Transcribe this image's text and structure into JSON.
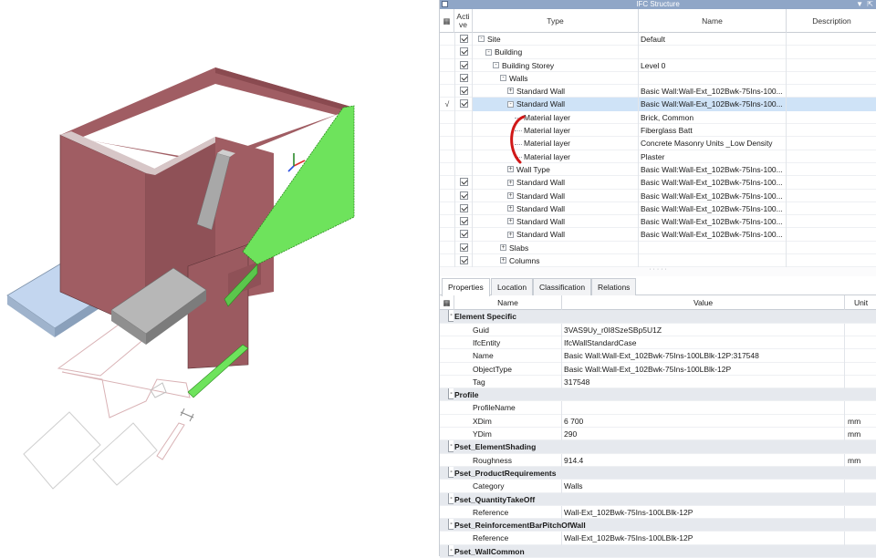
{
  "viewport": {
    "model_colors": {
      "wall": "#a05d63",
      "wall_top": "#d7d7d7",
      "selected": "#6ee35c",
      "slab": "#c3d6ef",
      "column": "#a8a8a8"
    }
  },
  "structure_panel": {
    "title": "IFC Structure",
    "columns": {
      "active": "Acti ve",
      "type": "Type",
      "name": "Name",
      "description": "Description"
    },
    "rows": [
      {
        "type": "Site",
        "name": "Default",
        "active": true,
        "marked": false
      },
      {
        "type": "Building",
        "name": "",
        "active": true,
        "marked": false
      },
      {
        "type": "Building Storey",
        "name": "Level 0",
        "active": true,
        "marked": false
      },
      {
        "type": "Walls",
        "name": "",
        "active": true,
        "marked": false
      },
      {
        "type": "Standard Wall",
        "name": "Basic Wall:Wall-Ext_102Bwk-75Ins-100...",
        "active": true,
        "marked": false
      },
      {
        "type": "Standard Wall",
        "name": "Basic Wall:Wall-Ext_102Bwk-75Ins-100...",
        "active": true,
        "marked": true
      },
      {
        "type": "Material layer",
        "name": "Brick, Common",
        "active": false,
        "marked": false
      },
      {
        "type": "Material layer",
        "name": "Fiberglass Batt",
        "active": false,
        "marked": false
      },
      {
        "type": "Material layer",
        "name": "Concrete Masonry Units _Low Density",
        "active": false,
        "marked": false
      },
      {
        "type": "Material layer",
        "name": "Plaster",
        "active": false,
        "marked": false
      },
      {
        "type": "Wall Type",
        "name": "Basic Wall:Wall-Ext_102Bwk-75Ins-100...",
        "active": false,
        "marked": false
      },
      {
        "type": "Standard Wall",
        "name": "Basic Wall:Wall-Ext_102Bwk-75Ins-100...",
        "active": true,
        "marked": false
      },
      {
        "type": "Standard Wall",
        "name": "Basic Wall:Wall-Ext_102Bwk-75Ins-100...",
        "active": true,
        "marked": false
      },
      {
        "type": "Standard Wall",
        "name": "Basic Wall:Wall-Ext_102Bwk-75Ins-100...",
        "active": true,
        "marked": false
      },
      {
        "type": "Standard Wall",
        "name": "Basic Wall:Wall-Ext_102Bwk-75Ins-100...",
        "active": true,
        "marked": false
      },
      {
        "type": "Standard Wall",
        "name": "Basic Wall:Wall-Ext_102Bwk-75Ins-100...",
        "active": true,
        "marked": false
      },
      {
        "type": "Slabs",
        "name": "",
        "active": true,
        "marked": false
      },
      {
        "type": "Columns",
        "name": "",
        "active": true,
        "marked": false
      }
    ],
    "mark_glyph": "√"
  },
  "tabs": [
    "Properties",
    "Location",
    "Classification",
    "Relations"
  ],
  "properties": {
    "columns": {
      "name": "Name",
      "value": "Value",
      "unit": "Unit"
    },
    "groups": [
      {
        "title": "Element Specific",
        "items": [
          {
            "name": "Guid",
            "value": "3VAS9Uy_r0I8SzeSBp5U1Z",
            "unit": ""
          },
          {
            "name": "IfcEntity",
            "value": "IfcWallStandardCase",
            "unit": ""
          },
          {
            "name": "Name",
            "value": "Basic Wall:Wall-Ext_102Bwk-75Ins-100LBlk-12P:317548",
            "unit": ""
          },
          {
            "name": "ObjectType",
            "value": "Basic Wall:Wall-Ext_102Bwk-75Ins-100LBlk-12P",
            "unit": ""
          },
          {
            "name": "Tag",
            "value": "317548",
            "unit": ""
          }
        ]
      },
      {
        "title": "Profile",
        "items": [
          {
            "name": "ProfileName",
            "value": "",
            "unit": ""
          },
          {
            "name": "XDim",
            "value": "6 700",
            "unit": "mm"
          },
          {
            "name": "YDim",
            "value": "290",
            "unit": "mm"
          }
        ]
      },
      {
        "title": "Pset_ElementShading",
        "items": [
          {
            "name": "Roughness",
            "value": "914.4",
            "unit": "mm"
          }
        ]
      },
      {
        "title": "Pset_ProductRequirements",
        "items": [
          {
            "name": "Category",
            "value": "Walls",
            "unit": ""
          }
        ]
      },
      {
        "title": "Pset_QuantityTakeOff",
        "items": [
          {
            "name": "Reference",
            "value": "Wall-Ext_102Bwk-75Ins-100LBlk-12P",
            "unit": ""
          }
        ]
      },
      {
        "title": "Pset_ReinforcementBarPitchOfWall",
        "items": [
          {
            "name": "Reference",
            "value": "Wall-Ext_102Bwk-75Ins-100LBlk-12P",
            "unit": ""
          }
        ]
      },
      {
        "title": "Pset_WallCommon",
        "items": []
      }
    ]
  }
}
